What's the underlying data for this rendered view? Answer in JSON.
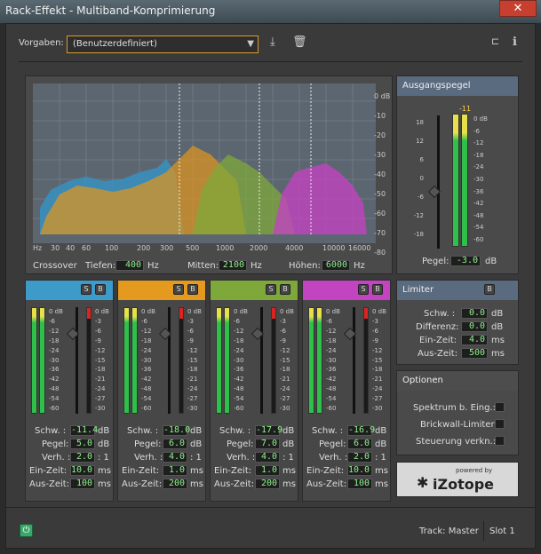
{
  "window": {
    "title": "Rack-Effekt - Multiband-Komprimierung",
    "close_icon": "close-icon"
  },
  "presets": {
    "label": "Vorgaben:",
    "value": "(Benutzerdefiniert)"
  },
  "graph": {
    "db_ticks": [
      "0 dB",
      "-10",
      "-20",
      "-30",
      "-40",
      "-50",
      "-60",
      "-70",
      "-80"
    ],
    "hz_ticks": [
      "Hz",
      "30",
      "40",
      "60",
      "100",
      "200",
      "300",
      "500",
      "1000",
      "2000",
      "4000",
      "10000",
      "16000"
    ]
  },
  "crossover": {
    "label": "Crossover",
    "low_label": "Tiefen:",
    "low_value": "400",
    "low_unit": "Hz",
    "mid_label": "Mitten:",
    "mid_value": "2100",
    "mid_unit": "Hz",
    "high_label": "Höhen:",
    "high_value": "6000",
    "high_unit": "Hz"
  },
  "output": {
    "title": "Ausgangspegel",
    "peak": "-11",
    "scale_left": [
      "18",
      "12",
      "6",
      "0",
      "-6",
      "-12",
      "-18"
    ],
    "scale_right": [
      "0 dB",
      "-6",
      "-12",
      "-18",
      "-24",
      "-30",
      "-36",
      "-42",
      "-48",
      "-54",
      "-60"
    ],
    "gain_label": "Pegel:",
    "gain_value": "-3.0",
    "gain_unit": "dB"
  },
  "limiter": {
    "title": "Limiter",
    "threshold_label": "Schw. :",
    "threshold_value": "0.0",
    "threshold_unit": "dB",
    "margin_label": "Differenz:",
    "margin_value": "0.0",
    "margin_unit": "dB",
    "attack_label": "Ein-Zeit:",
    "attack_value": "4.0",
    "attack_unit": "ms",
    "release_label": "Aus-Zeit:",
    "release_value": "500",
    "release_unit": "ms",
    "solo": "B"
  },
  "options": {
    "title": "Optionen",
    "opt1": "Spektrum b. Eing.:",
    "opt2": "Brickwall-Limiter:",
    "opt3": "Steuerung verkn.:"
  },
  "bands": [
    {
      "color": "#3d9bc9",
      "threshold": "-11.4",
      "gain": "5.0",
      "ratio": "2.0",
      "attack": "10.0",
      "release": "100"
    },
    {
      "color": "#e39a1e",
      "threshold": "-18.0",
      "gain": "6.0",
      "ratio": "4.0",
      "attack": "1.0",
      "release": "200"
    },
    {
      "color": "#7fa83a",
      "threshold": "-17.9",
      "gain": "7.0",
      "ratio": "4.0",
      "attack": "1.0",
      "release": "200"
    },
    {
      "color": "#c244c0",
      "threshold": "-16.9",
      "gain": "6.0",
      "ratio": "2.0",
      "attack": "10.0",
      "release": "100"
    }
  ],
  "band_labels": {
    "threshold": "Schw. :",
    "gain": "Pegel:",
    "ratio": "Verh. :",
    "attack": "Ein-Zeit:",
    "release": "Aus-Zeit:",
    "db": "dB",
    "ms": "ms",
    "ratio_suffix": ": 1",
    "solo": "S",
    "bypass": "B"
  },
  "band_meter_left": [
    "0 dB",
    "-6",
    "-12",
    "-18",
    "-24",
    "-30",
    "-36",
    "-42",
    "-48",
    "-54",
    "-60"
  ],
  "band_meter_right": [
    "0 dB",
    "-3",
    "-6",
    "-9",
    "-12",
    "-15",
    "-18",
    "-21",
    "-24",
    "-27",
    "-30"
  ],
  "brand": {
    "powered": "powered by",
    "name": "iZotope"
  },
  "footer": {
    "track": "Track: Master",
    "slot": "Slot 1"
  }
}
